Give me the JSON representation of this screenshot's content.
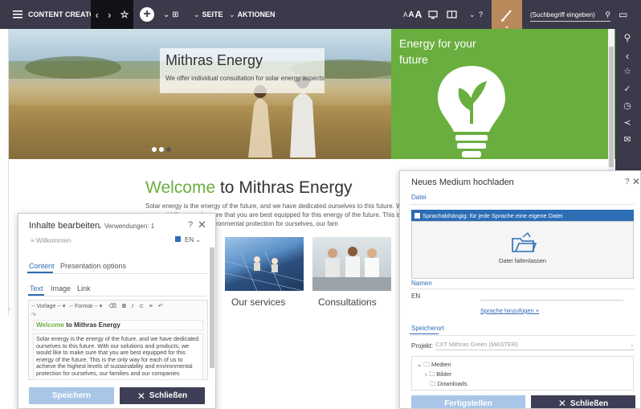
{
  "topbar": {
    "app_title": "CONTENT CREATOR",
    "seite_label": "SEITE",
    "aktionen_label": "AKTIONEN",
    "font_size_small": "A",
    "font_size_med": "A",
    "font_size_large": "A",
    "help": "?",
    "search_placeholder": "(Suchbegriff eingeben)"
  },
  "hero": {
    "title": "Mithras Energy",
    "subtitle": "We offer individual consultation for solar energy aspects"
  },
  "promo": {
    "title": "Energy for your future"
  },
  "welcome": {
    "accent": "Welcome",
    "rest": " to Mithras Energy",
    "body_line1": "Solar energy is the energy of the future, and we have dedicated ourselves to this future. With c",
    "body_line2": "we would like to make sure that you are best equipped for this energy of the future. This is the",
    "body_line3": "of sustainability and environmental protection for ourselves, our fam"
  },
  "cards": [
    {
      "label": "Our services"
    },
    {
      "label": "Consultations"
    }
  ],
  "edit_dialog": {
    "title": "Inhalte bearbeiten",
    "usages": "Verwendungen: 1",
    "help": "?",
    "record": "Willkommen",
    "lang": "EN",
    "tabs": [
      "Content",
      "Presentation options"
    ],
    "subtabs": [
      "Text",
      "Image",
      "Link"
    ],
    "toolbar": {
      "vorlage": "-- Vorlage --",
      "format": "-- Format --",
      "bold": "B",
      "italic": "I"
    },
    "heading_accent": "Welcome",
    "heading_rest": " to Mithras Energy",
    "body": "Solar energy is the energy of the future, and we have dedicated ourselves to this future. With our solutions and products, we would like to make sure that you are best equipped for this energy of the future. This is the only way for each of us to achieve the highest levels of sustainability and environmental protection for ourselves, our families and our companies",
    "save": "Speichern",
    "close": "Schließen"
  },
  "upload_dialog": {
    "title": "Neues Medium hochladen",
    "help": "?",
    "section_file": "Datei",
    "lang_dependent": "Sprachabhängig: für jede Sprache eine eigene Datei",
    "drop_label": "Datei fallenlassen",
    "section_names": "Namen",
    "lang_code": "EN",
    "add_language": "Sprache hinzufügen +",
    "section_location": "Speicherort",
    "project_label": "Projekt:",
    "project_value": "CXT Mithras Green (MASTER)",
    "tree": [
      "Medien",
      "Bilder",
      "Downloads"
    ],
    "finish": "Fertigstellen",
    "close": "Schließen"
  }
}
